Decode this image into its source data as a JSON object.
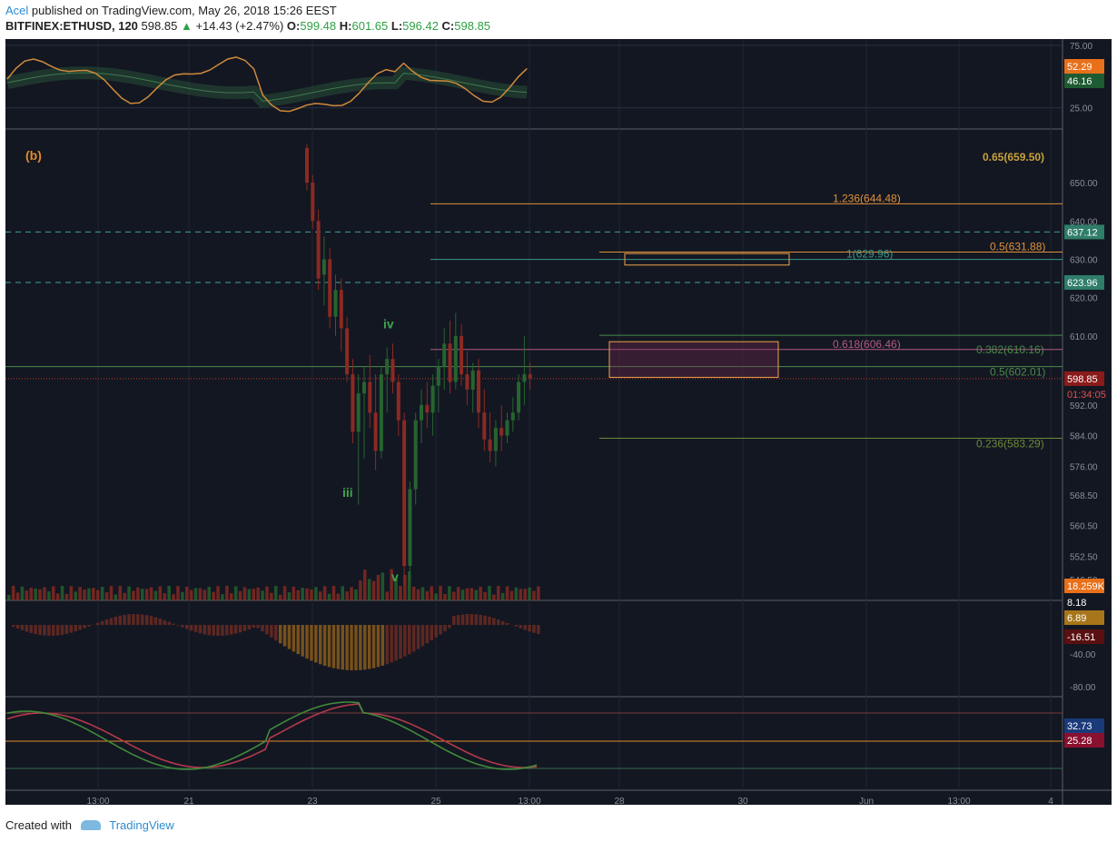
{
  "header": {
    "author": "Acel",
    "published": "published on TradingView.com, May 26, 2018 15:26 EEST",
    "symbol": "BITFINEX:ETHUSD, 120",
    "last": "598.85",
    "change": "+14.43 (+2.47%)",
    "o_label": "O:",
    "o_value": "599.48",
    "h_label": "H:",
    "h_value": "601.65",
    "l_label": "L:",
    "l_value": "596.42",
    "c_label": "C:",
    "c_value": "598.85"
  },
  "footer": {
    "created_with": "Created with",
    "brand": "TradingView"
  },
  "colors": {
    "background": "#131722",
    "up": "#26642f",
    "down": "#8b2a22",
    "fib_orange": "#e0903a",
    "fib_green": "#4b8a4a",
    "fib_teal": "#3a9a8a",
    "fib_pink": "#b35a83",
    "zone_orange": "#f0a24a"
  },
  "chart_data": {
    "type": "candlestick",
    "symbol": "BITFINEX:ETHUSD",
    "interval": "120",
    "price_axis_ticks": [
      "650.00",
      "640.00",
      "630.00",
      "620.00",
      "610.00",
      "600.00",
      "592.00",
      "584.00",
      "576.00",
      "568.50",
      "560.50",
      "552.50",
      "546.50"
    ],
    "time_axis_ticks": [
      "13:00",
      "21",
      "23",
      "25",
      "13:00",
      "28",
      "30",
      "Jun",
      "13:00",
      "4"
    ],
    "price_range": [
      541,
      664
    ],
    "candles_ohlc": [
      [
        659,
        660,
        648,
        650
      ],
      [
        650,
        652,
        638,
        640
      ],
      [
        640,
        643,
        622,
        625
      ],
      [
        626,
        636,
        618,
        630
      ],
      [
        630,
        633,
        612,
        615
      ],
      [
        615,
        626,
        610,
        622
      ],
      [
        622,
        625,
        606,
        612
      ],
      [
        612,
        615,
        598,
        600
      ],
      [
        600,
        604,
        582,
        585
      ],
      [
        585,
        600,
        566,
        595
      ],
      [
        595,
        602,
        578,
        598
      ],
      [
        598,
        605,
        586,
        590
      ],
      [
        590,
        600,
        575,
        580
      ],
      [
        580,
        602,
        578,
        600
      ],
      [
        600,
        607,
        590,
        604
      ],
      [
        604,
        608,
        595,
        598
      ],
      [
        598,
        600,
        584,
        588
      ],
      [
        588,
        590,
        545,
        550
      ],
      [
        550,
        572,
        546,
        570
      ],
      [
        570,
        590,
        566,
        588
      ],
      [
        588,
        596,
        582,
        592
      ],
      [
        592,
        598,
        586,
        590
      ],
      [
        590,
        600,
        584,
        597
      ],
      [
        597,
        604,
        590,
        602
      ],
      [
        602,
        612,
        596,
        608
      ],
      [
        608,
        614,
        595,
        598
      ],
      [
        598,
        616,
        596,
        610
      ],
      [
        610,
        613,
        597,
        600
      ],
      [
        600,
        606,
        592,
        596
      ],
      [
        596,
        603,
        590,
        601
      ],
      [
        601,
        604,
        586,
        590
      ],
      [
        590,
        596,
        580,
        583
      ],
      [
        583,
        590,
        577,
        580
      ],
      [
        580,
        588,
        576,
        586
      ],
      [
        586,
        592,
        580,
        584
      ],
      [
        584,
        590,
        582,
        588
      ],
      [
        588,
        594,
        585,
        590
      ],
      [
        590,
        600,
        588,
        598
      ],
      [
        598,
        610,
        592,
        600
      ],
      [
        600,
        603,
        596,
        599
      ]
    ],
    "fib_levels": [
      {
        "label": "0.65(659.50)",
        "value": 659.5
      },
      {
        "label": "1.236(644.48)",
        "value": 644.48
      },
      {
        "label": "0.5(631.88)",
        "value": 631.88
      },
      {
        "label": "1(629.96)",
        "value": 629.96
      },
      {
        "label": "0.382(610.16)",
        "value": 610.16
      },
      {
        "label": "0.618(606.46)",
        "value": 606.46
      },
      {
        "label": "0.5(602.01)",
        "value": 602.01
      },
      {
        "label": "0.236(583.29)",
        "value": 583.29
      }
    ],
    "horizontal_levels": [
      {
        "label": "637.12",
        "value": 637.12
      },
      {
        "label": "623.96",
        "value": 623.96
      }
    ],
    "current_price": {
      "label": "598.85",
      "value": 598.85,
      "countdown": "01:34:05"
    },
    "wave_labels": [
      {
        "text": "(b)",
        "price": 656
      },
      {
        "text": "iv",
        "price": 612
      },
      {
        "text": "iii",
        "price": 568
      },
      {
        "text": "v",
        "price": 546
      }
    ],
    "zones": [
      {
        "from": 631.5,
        "to": 628.5
      },
      {
        "from": 608.5,
        "to": 599.2
      }
    ],
    "rsi_panel": {
      "ticks": [
        "75.00",
        "25.00"
      ],
      "values": {
        "rsi": "52.29",
        "ma": "46.16"
      }
    },
    "volume": {
      "value": "18.259K",
      "value2": "8.185K"
    },
    "macd_panel": {
      "ticks": [
        "-40.00",
        "-80.00"
      ],
      "values": {
        "macd": "6.89",
        "hist": "-16.51",
        "zero": "8.18"
      }
    },
    "stoch_panel": {
      "values": {
        "k": "32.73",
        "d": "25.28"
      }
    }
  }
}
